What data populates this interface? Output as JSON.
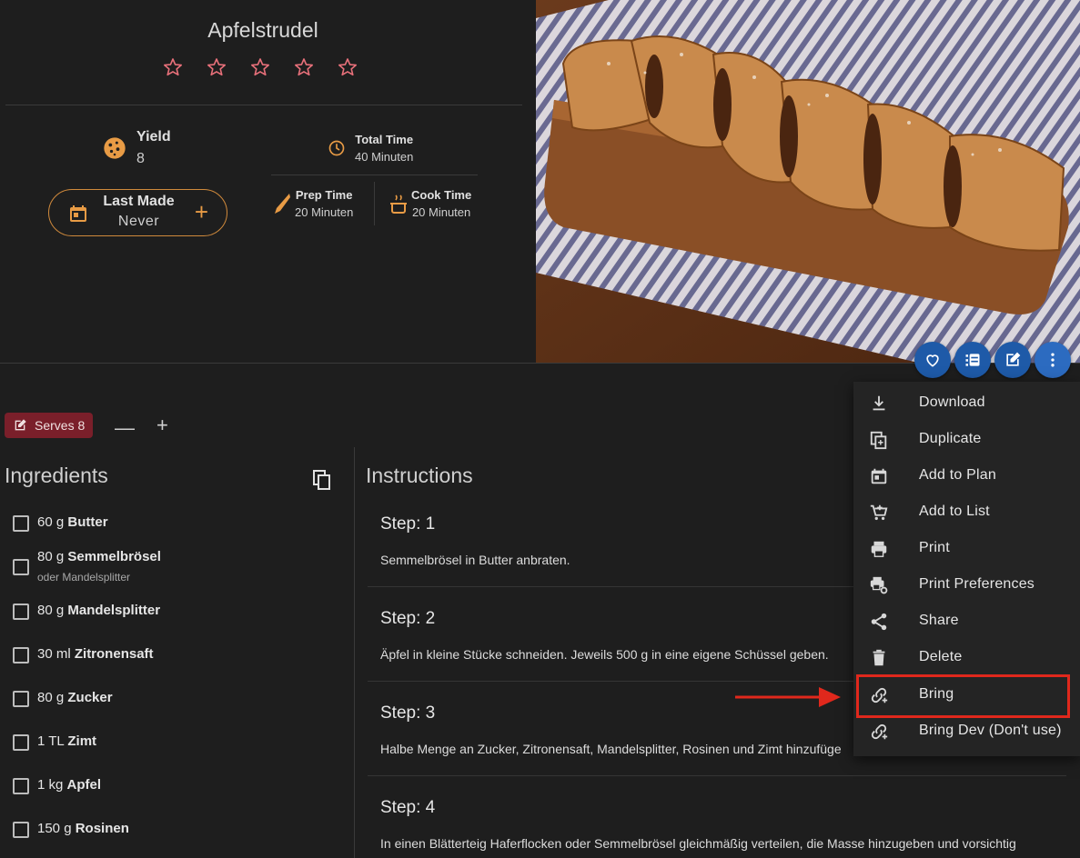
{
  "recipe": {
    "title": "Apfelstrudel",
    "rating_stars": 0,
    "yield_label": "Yield",
    "yield_value": "8",
    "last_made_label": "Last Made",
    "last_made_value": "Never",
    "total_time_label": "Total Time",
    "total_time_value": "40 Minuten",
    "prep_time_label": "Prep Time",
    "prep_time_value": "20 Minuten",
    "cook_time_label": "Cook Time",
    "cook_time_value": "20 Minuten"
  },
  "serves": {
    "label": "Serves 8",
    "minus": "—",
    "plus": "+"
  },
  "ingredients": {
    "title": "Ingredients",
    "items": [
      {
        "qty": "60 g",
        "name": "Butter",
        "note": ""
      },
      {
        "qty": "80 g",
        "name": "Semmelbrösel",
        "note": "oder Mandelsplitter"
      },
      {
        "qty": "80 g",
        "name": "Mandelsplitter",
        "note": ""
      },
      {
        "qty": "30 ml",
        "name": "Zitronensaft",
        "note": ""
      },
      {
        "qty": "80 g",
        "name": "Zucker",
        "note": ""
      },
      {
        "qty": "1 TL",
        "name": "Zimt",
        "note": ""
      },
      {
        "qty": "1 kg",
        "name": "Apfel",
        "note": ""
      },
      {
        "qty": "150 g",
        "name": "Rosinen",
        "note": ""
      }
    ]
  },
  "instructions": {
    "title": "Instructions",
    "steps": [
      {
        "heading": "Step: 1",
        "text": "Semmelbrösel in Butter anbraten."
      },
      {
        "heading": "Step: 2",
        "text": "Äpfel in kleine Stücke schneiden. Jeweils 500 g in eine eigene Schüssel geben."
      },
      {
        "heading": "Step: 3",
        "text": "Halbe Menge an Zucker, Zitronensaft, Mandelsplitter, Rosinen und Zimt hinzufüge"
      },
      {
        "heading": "Step: 4",
        "text": "In einen Blätterteig Haferflocken oder Semmelbrösel gleichmäßig verteilen, die Masse hinzugeben und vorsichtig"
      }
    ]
  },
  "menu": {
    "items": [
      {
        "label": "Download",
        "icon": "download-icon"
      },
      {
        "label": "Duplicate",
        "icon": "duplicate-icon"
      },
      {
        "label": "Add to Plan",
        "icon": "calendar-icon"
      },
      {
        "label": "Add to List",
        "icon": "cart-plus-icon"
      },
      {
        "label": "Print",
        "icon": "printer-icon"
      },
      {
        "label": "Print Preferences",
        "icon": "printer-settings-icon"
      },
      {
        "label": "Share",
        "icon": "share-icon"
      },
      {
        "label": "Delete",
        "icon": "trash-icon"
      },
      {
        "label": "Bring",
        "icon": "link-plus-icon"
      },
      {
        "label": "Bring Dev (Don't use)",
        "icon": "link-plus-icon"
      }
    ]
  },
  "colors": {
    "accent_orange": "#e89b45",
    "star_color": "#e8707a",
    "fab_blue": "#1e5aa8",
    "serves_bg": "#7a1f2a",
    "highlight_red": "#e0281c"
  }
}
